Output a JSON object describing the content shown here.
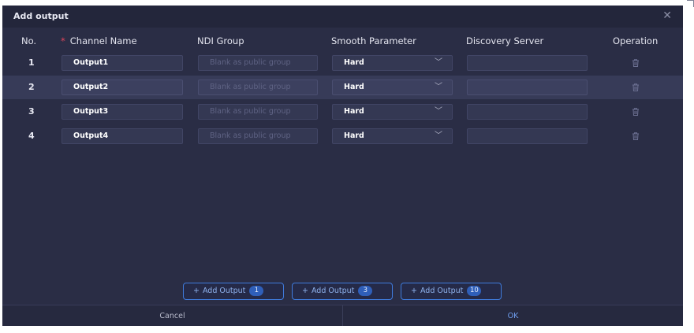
{
  "dialog": {
    "title": "Add output",
    "close_icon": "close-icon"
  },
  "columns": {
    "no": "No.",
    "channel_name": "Channel Name",
    "ndi_group": "NDI Group",
    "smooth_parameter": "Smooth Parameter",
    "discovery_server": "Discovery Server",
    "operation": "Operation"
  },
  "rows": [
    {
      "no": "1",
      "channel_name": "Output1",
      "ndi_group_placeholder": "Blank as public group",
      "smooth": "Hard",
      "discovery_server": "",
      "delete_icon": "trash-icon"
    },
    {
      "no": "2",
      "channel_name": "Output2",
      "ndi_group_placeholder": "Blank as public group",
      "smooth": "Hard",
      "discovery_server": "",
      "delete_icon": "trash-icon"
    },
    {
      "no": "3",
      "channel_name": "Output3",
      "ndi_group_placeholder": "Blank as public group",
      "smooth": "Hard",
      "discovery_server": "",
      "delete_icon": "trash-icon"
    },
    {
      "no": "4",
      "channel_name": "Output4",
      "ndi_group_placeholder": "Blank as public group",
      "smooth": "Hard",
      "discovery_server": "",
      "delete_icon": "trash-icon"
    }
  ],
  "add_buttons": [
    {
      "label": "Add Output",
      "count": "1"
    },
    {
      "label": "Add Output",
      "count": "3"
    },
    {
      "label": "Add Output",
      "count": "10"
    }
  ],
  "footer": {
    "cancel": "Cancel",
    "ok": "OK"
  },
  "colors": {
    "accent": "#3f7bdc",
    "required": "#e0455b",
    "background": "#2a2d45"
  }
}
